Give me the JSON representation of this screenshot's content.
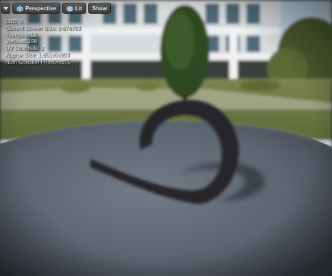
{
  "toolbar": {
    "menu_icon": "chevron-down-icon",
    "perspective_icon": "perspective-cube-icon",
    "perspective_label": "Perspective",
    "lit_icon": "lit-sphere-icon",
    "lit_label": "Lit",
    "show_label": "Show"
  },
  "stats": [
    {
      "label": "LOD:",
      "value": "0"
    },
    {
      "label": "Current Screen Size:",
      "value": "0.676703"
    },
    {
      "label": "Triangles:",
      "value": "98"
    },
    {
      "label": "Vertices:",
      "value": "196"
    },
    {
      "label": "UV Channels:",
      "value": "2"
    },
    {
      "label": "Approx Size:",
      "value": "1,651x0x903"
    },
    {
      "label": "Num Collision Primitives:",
      "value": "0"
    }
  ],
  "colors": {
    "sky": "#cfe0ec",
    "grass": "#6f7a45",
    "floor": "#5c6470",
    "mesh": "#232528"
  }
}
